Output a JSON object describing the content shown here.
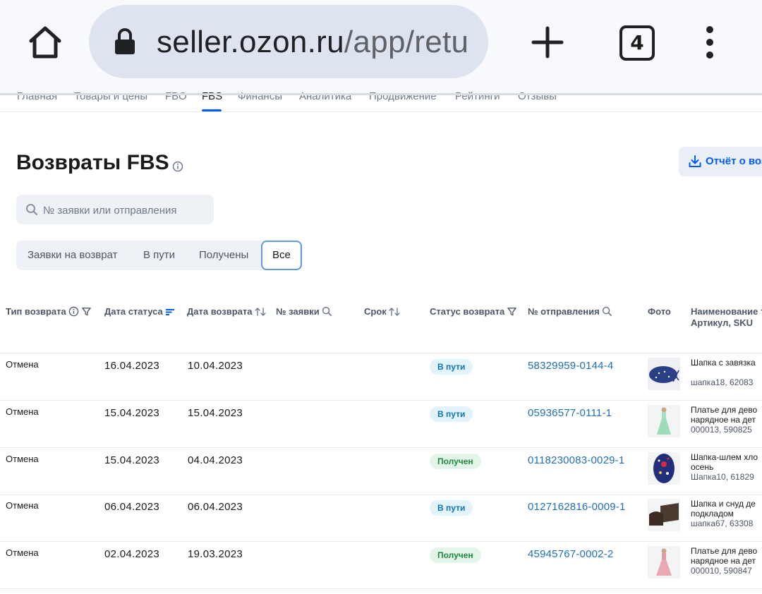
{
  "browser": {
    "url_host": "seller.ozon.ru",
    "url_path": "/app/retu",
    "tab_count": "4"
  },
  "nav": {
    "items": [
      "Главная",
      "Товары и цены",
      "FBO",
      "FBS",
      "Финансы",
      "Аналитика",
      "Продвижение",
      "Рейтинги",
      "Отзывы"
    ],
    "active": "FBS"
  },
  "page": {
    "title": "Возвраты FBS",
    "report_button": "Отчёт о воз"
  },
  "search": {
    "placeholder": "№ заявки или отправления",
    "value": ""
  },
  "filters": {
    "tabs": [
      "Заявки на возврат",
      "В пути",
      "Получены",
      "Все"
    ],
    "active": "Все"
  },
  "table": {
    "headers": {
      "type": "Тип возврата",
      "status_date": "Дата статуса",
      "return_date": "Дата возврата",
      "request_no": "№ заявки",
      "deadline": "Срок",
      "return_status": "Статус возврата",
      "shipment_no": "№ отправления",
      "photo": "Фото",
      "name_line1": "Наименование т",
      "name_line2": "Артикул, SKU"
    },
    "rows": [
      {
        "type": "Отмена",
        "status_date": "16.04.2023",
        "return_date": "10.04.2023",
        "status": "В пути",
        "status_kind": "transit",
        "shipment": "58329959-0144-4",
        "name": [
          "Шапка с завязка",
          "",
          "шапка18, 62083"
        ],
        "photo": "blue-hat"
      },
      {
        "type": "Отмена",
        "status_date": "15.04.2023",
        "return_date": "15.04.2023",
        "status": "В пути",
        "status_kind": "transit",
        "shipment": "05936577-0111-1",
        "name": [
          "Платье для дево",
          "нарядное на дет",
          "000013, 590825"
        ],
        "photo": "green-dress"
      },
      {
        "type": "Отмена",
        "status_date": "15.04.2023",
        "return_date": "04.04.2023",
        "status": "Получен",
        "status_kind": "received",
        "shipment": "0118230083-0029-1",
        "name": [
          "Шапка-шлем хло",
          "осень",
          "Шапка10, 61829"
        ],
        "photo": "floral-helmet"
      },
      {
        "type": "Отмена",
        "status_date": "06.04.2023",
        "return_date": "06.04.2023",
        "status": "В пути",
        "status_kind": "transit",
        "shipment": "0127162816-0009-1",
        "name": [
          "Шапка и снуд де",
          "подкладом",
          "шапка67, 63308"
        ],
        "photo": "brown-set"
      },
      {
        "type": "Отмена",
        "status_date": "02.04.2023",
        "return_date": "19.03.2023",
        "status": "Получен",
        "status_kind": "received",
        "shipment": "45945767-0002-2",
        "name": [
          "Платье для дево",
          "нарядное на дет",
          "000010, 590847"
        ],
        "photo": "pink-dress"
      }
    ]
  },
  "colors": {
    "accent": "#005bff",
    "link": "#1f6fb8",
    "transit_bg": "#e3f3fb",
    "received_bg": "#e3f5e8"
  }
}
